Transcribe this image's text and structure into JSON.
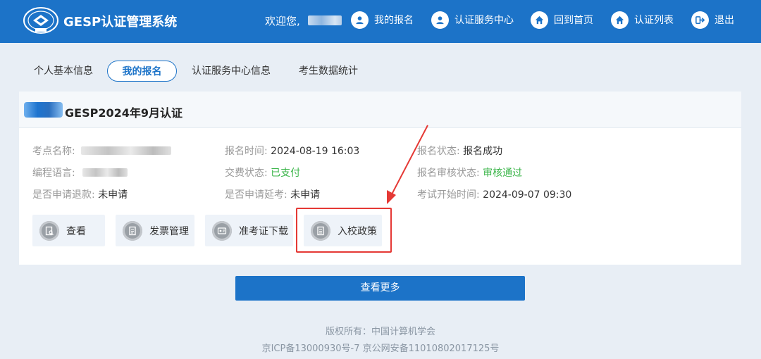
{
  "header": {
    "app_title": "GESP认证管理系统",
    "welcome_text": "欢迎您,",
    "nav": [
      {
        "label": "我的报名",
        "icon": "user-icon"
      },
      {
        "label": "认证服务中心",
        "icon": "user-icon"
      },
      {
        "label": "回到首页",
        "icon": "home-icon"
      },
      {
        "label": "认证列表",
        "icon": "home-icon"
      },
      {
        "label": "退出",
        "icon": "logout-icon"
      }
    ]
  },
  "tabs": [
    {
      "label": "个人基本信息"
    },
    {
      "label": "我的报名",
      "active": true
    },
    {
      "label": "认证服务中心信息"
    },
    {
      "label": "考生数据统计"
    }
  ],
  "registration": {
    "title": "GESP2024年9月认证",
    "fields": {
      "test_center": {
        "label": "考点名称:"
      },
      "language": {
        "label": "编程语言:"
      },
      "refund": {
        "label": "是否申请退款:",
        "value": "未申请"
      },
      "reg_time": {
        "label": "报名时间:",
        "value": "2024-08-19 16:03"
      },
      "pay_status": {
        "label": "交费状态:",
        "value": "已支付"
      },
      "postpone": {
        "label": "是否申请延考:",
        "value": "未申请"
      },
      "reg_status": {
        "label": "报名状态:",
        "value": "报名成功"
      },
      "review_status": {
        "label": "报名审核状态:",
        "value": "审核通过"
      },
      "exam_start": {
        "label": "考试开始时间:",
        "value": "2024-09-07 09:30"
      }
    },
    "actions": [
      {
        "label": "查看",
        "icon": "view-doc-icon"
      },
      {
        "label": "发票管理",
        "icon": "invoice-icon"
      },
      {
        "label": "准考证下载",
        "icon": "id-card-icon"
      },
      {
        "label": "入校政策",
        "icon": "policy-doc-icon"
      }
    ]
  },
  "more_button": "查看更多",
  "footer": {
    "copyright": "版权所有：中国计算机学会",
    "icp": "京ICP备13000930号-7 京公网安备11010802017125号"
  },
  "colors": {
    "primary": "#1c73c8",
    "success": "#3bb54a",
    "annotation": "#e53935"
  }
}
